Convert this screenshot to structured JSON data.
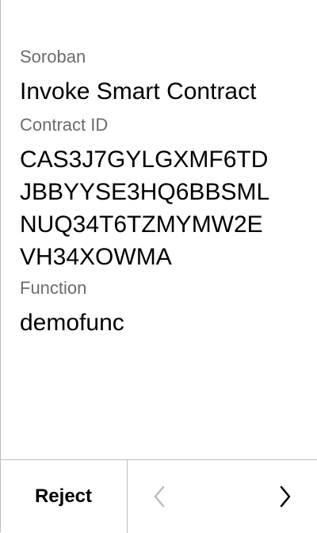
{
  "header": {
    "app_name": "Soroban",
    "title": "Invoke Smart Contract"
  },
  "contract": {
    "label": "Contract ID",
    "id_lines": [
      "CAS3J7GYLGXMF6TD",
      "JBBYYSE3HQ6BBSML",
      "NUQ34T6TZMYMW2E",
      "VH34XOWMA"
    ]
  },
  "function": {
    "label": "Function",
    "name": "demofunc"
  },
  "footer": {
    "reject_label": "Reject",
    "prev_icon": "chevron-left-icon",
    "next_icon": "chevron-right-icon",
    "prev_color": "#bdbdbd",
    "next_color": "#000000"
  }
}
